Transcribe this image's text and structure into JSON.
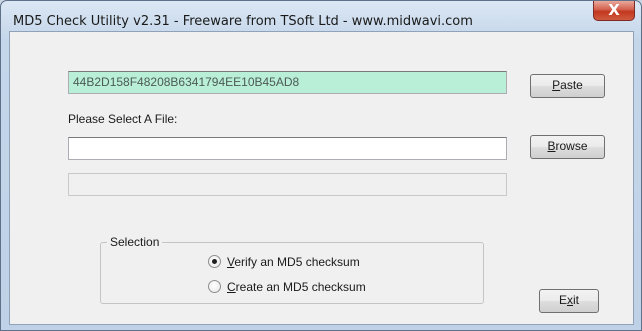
{
  "window": {
    "title": "MD5 Check Utility v2.31 - Freeware from TSoft Ltd - www.midwavi.com",
    "close_label": "X"
  },
  "md5_field": {
    "value": "44B2D158F48208B6341794EE10B45AD8"
  },
  "paste_button": {
    "mnemonic": "P",
    "rest": "aste"
  },
  "select_file_label": "Please Select A File:",
  "file_field": {
    "value": ""
  },
  "browse_button": {
    "mnemonic": "B",
    "rest": "rowse"
  },
  "progress_field": {
    "value": ""
  },
  "selection": {
    "title": "Selection",
    "options": [
      {
        "mnemonic": "V",
        "rest": "erify an MD5 checksum",
        "checked": true
      },
      {
        "mnemonic": "C",
        "rest": "reate an MD5 checksum",
        "checked": false
      }
    ]
  },
  "exit_button": {
    "pre": "E",
    "mnemonic": "x",
    "rest": "it"
  },
  "colors": {
    "md5_field_bg": "#b8efd6",
    "close_button": "#c2371f"
  }
}
